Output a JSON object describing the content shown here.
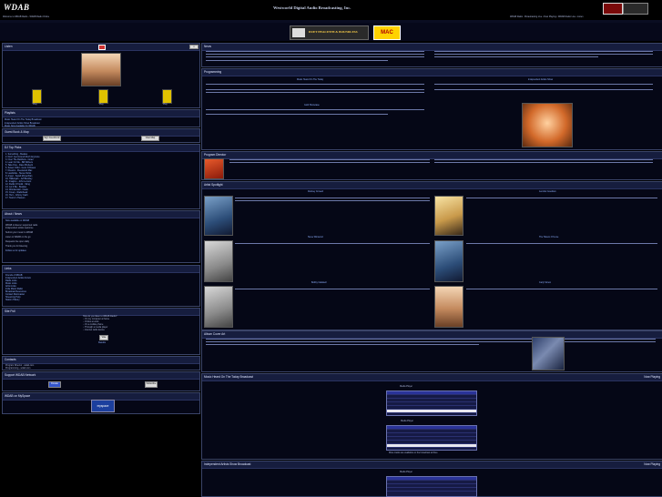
{
  "header": {
    "logo": "WDAB",
    "title": "Westworld Digital Audio Broadcasting, Inc.",
    "left_status": "Welcome to WDAB Radio - WDAB Radio Online",
    "right_status": "WDAB Radio - Broadcasting Live • Now Playing • WDAB Radio Live • Listen"
  },
  "banner": {
    "ad_title": "DUET HYACINTH & BOUNDLESS",
    "ad_right": "MAC"
  },
  "left": {
    "listen": {
      "title": "Listen",
      "pills": [
        "Play",
        "Play",
        "Play"
      ],
      "photo_caption": "WDAB Radio"
    },
    "playlists": {
      "title": "Playlists",
      "items": [
        "Music Heard On The Today Broadcast",
        "Independent Artists Show Broadcast",
        "Music Now Available On WDAB"
      ]
    },
    "guestbook": {
      "title": "Guest Book & Map",
      "buttons": [
        "Sign Guestbook",
        "View Map"
      ]
    },
    "top_tracks": {
      "title": "DJ Top Picks",
      "items": [
        "1. Something - Beatles",
        "2. Don't Get Around Much Anymore",
        "3. Over The Rainbow - Israel",
        "4. Lean On Me - Bill Withers",
        "5. Take Five - Dave Brubeck",
        "6. Sweet Child - Guns N Roses",
        "7. Dreams - Fleetwood Mac",
        "8. Landslide - Stevie Nicks",
        "9. Angel - Sarah McLachlan",
        "10. Hallelujah - Jeff Buckley",
        "11. Imagine - John Lennon",
        "12. Fields Of Gold - Sting",
        "13. Let It Be - Beatles",
        "14. Wonderwall - Oasis",
        "15. Creep - Radiohead",
        "16. Hurt - Johnny Cash",
        "17. Tears In Heaven"
      ]
    },
    "about": {
      "title": "About / News",
      "items": [
        "Now available on WDAB",
        "WDAB is listener supported radio",
        "Independent artists welcome",
        "Submit your music to WDAB",
        "Listen to WDAB on the go",
        "Requests line open daily",
        "Thank you for listening",
        "Follow us for updates"
      ]
    },
    "links": {
      "title": "Links",
      "items": [
        "Friends of WDAB",
        "Independent Artists Forum",
        "Radio Links",
        "Music Links",
        "Artist Links",
        "Indie Music Radio",
        "Broadcast Resources",
        "Contact Webmaster",
        "Streaming Help",
        "Station History"
      ]
    },
    "poll": {
      "title": "Site Poll",
      "question": "How do you listen to WDAB Radio?",
      "options": [
        "On my computer at home",
        "Online at work",
        "On a mobile phone",
        "Through a media player",
        "Internet radio device"
      ],
      "vote": "Vote",
      "results": "Results"
    },
    "contact": {
      "title": "Contacts",
      "items": [
        "Program Director - wdab.com",
        "Programming - wdab.com"
      ]
    },
    "support": {
      "title": "Support WDAB Network",
      "buttons": [
        "Donate",
        "Subscribe"
      ]
    },
    "myspace": {
      "title": "WDAB on MySpace",
      "badge": "myspace"
    }
  },
  "main": {
    "news": {
      "title": "News"
    },
    "programming": {
      "title": "Programming",
      "sub_left": "Music Heard On The Today",
      "sub_right": "Independent Artists Show",
      "sub_left2": "Gold Showcase"
    },
    "director": {
      "title": "Program Director"
    },
    "artists": {
      "title": "Artist Spotlight",
      "names": [
        "Rodney Crowell",
        "Jennifer Goodwin",
        "Steve Winwood",
        "The Tokens Of Love",
        "Bobby Caldwell",
        "Carly Simon"
      ]
    },
    "album": {
      "title": "Album Cover Art"
    },
    "today": {
      "title": "Music Heard On The Today Broadcast",
      "right": "Now Playing",
      "player_title": "Media Player",
      "player_more": "More tracks are available on the broadcast archive"
    },
    "indie": {
      "title": "Independent Artists Show Broadcast",
      "right": "Now Playing",
      "player_title": "Media Player"
    }
  },
  "colors": {
    "accent": "#8fb0ff",
    "panel_head": "#161d3e",
    "border": "#3a4468"
  }
}
